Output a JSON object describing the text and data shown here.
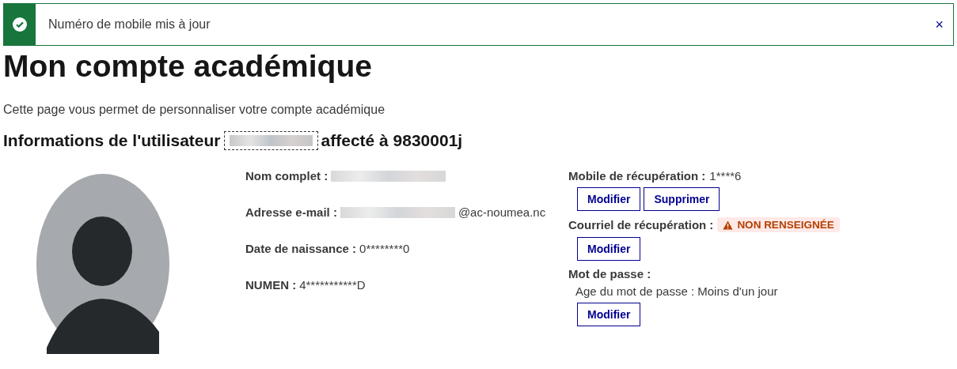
{
  "notification": {
    "kind": "success",
    "message": "Numéro de mobile mis à jour",
    "close": "×"
  },
  "title": "Mon compte académique",
  "intro": "Cette page vous permet de personnaliser votre compte académique",
  "heading": {
    "prefix": "Informations de l'utilisateur",
    "redacted": true,
    "suffix": "affecté à 9830001j"
  },
  "profile": [
    {
      "label": "Nom complet :",
      "redacted": true
    },
    {
      "label": "Adresse e-mail :",
      "redacted": true,
      "value": "@ac-noumea.nc"
    },
    {
      "label": "Date de naissance :",
      "redacted": false,
      "value": "0********0"
    },
    {
      "label": "NUMEN :",
      "redacted": false,
      "value": "4***********D"
    }
  ],
  "recovery": [
    {
      "label": "Mobile de récupération :",
      "value": "1****6",
      "buttons": [
        "Modifier",
        "Supprimer"
      ]
    },
    {
      "label": "Courriel de récupération :",
      "badge": {
        "kind": "warning",
        "text": "NON RENSEIGNÉE"
      },
      "buttons": [
        "Modifier"
      ]
    },
    {
      "label": "Mot de passe :",
      "note": "Age du mot de passe : Moins d'un jour",
      "buttons": [
        "Modifier"
      ]
    }
  ]
}
